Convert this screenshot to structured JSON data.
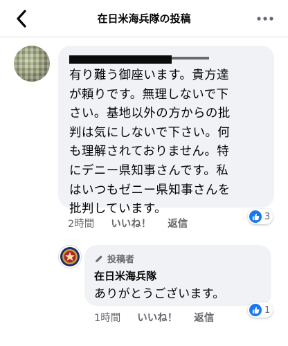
{
  "header": {
    "title": "在日米海兵隊の投稿",
    "back_icon": "chevron-left-icon",
    "more_icon": "ellipsis-icon"
  },
  "comment": {
    "text": "有り難う御座います。貴方達\nが頼りです。無理しないで下\nさい。基地以外の方からの批\n判は気にしないで下さい。何\nも理解されておりません。特\nにデニー県知事さんです。私\nはいつもゼニー県知事さんを\n批判しています。",
    "time": "2時間",
    "like_label": "いいね！",
    "reply_label": "返信",
    "reaction_count": "3"
  },
  "reply": {
    "badge_label": "投稿者",
    "author_name": "在日米海兵隊",
    "text": "ありがとうございます。",
    "time": "1時間",
    "like_label": "いいね！",
    "reply_label": "返信",
    "reaction_count": "1"
  },
  "colors": {
    "accent": "#1877f2",
    "bubble": "#f0f2f5",
    "meta": "#65676b"
  }
}
